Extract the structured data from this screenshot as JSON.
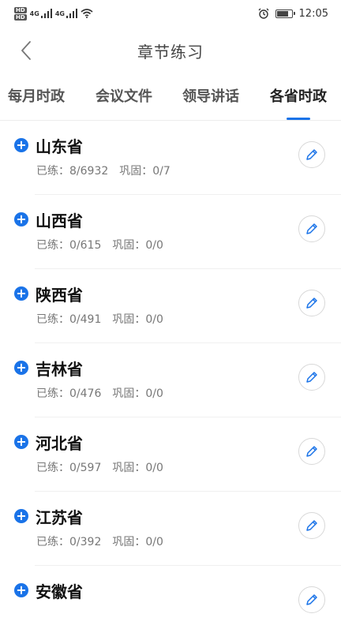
{
  "status_bar": {
    "time": "12:05",
    "network_1": "4G",
    "network_2": "4G",
    "hd_1": "HD",
    "hd_2": "HD"
  },
  "header": {
    "title": "章节练习"
  },
  "tabs": [
    {
      "label": "每月时政",
      "active": false
    },
    {
      "label": "会议文件",
      "active": false
    },
    {
      "label": "领导讲话",
      "active": false
    },
    {
      "label": "各省时政",
      "active": true
    }
  ],
  "accent_color": "#1a73e8",
  "items": [
    {
      "name": "山东省",
      "practiced_label": "已练：",
      "practiced": "8/6932",
      "review_label": "巩固：",
      "review": "0/7"
    },
    {
      "name": "山西省",
      "practiced_label": "已练：",
      "practiced": "0/615",
      "review_label": "巩固：",
      "review": "0/0"
    },
    {
      "name": "陕西省",
      "practiced_label": "已练：",
      "practiced": "0/491",
      "review_label": "巩固：",
      "review": "0/0"
    },
    {
      "name": "吉林省",
      "practiced_label": "已练：",
      "practiced": "0/476",
      "review_label": "巩固：",
      "review": "0/0"
    },
    {
      "name": "河北省",
      "practiced_label": "已练：",
      "practiced": "0/597",
      "review_label": "巩固：",
      "review": "0/0"
    },
    {
      "name": "江苏省",
      "practiced_label": "已练：",
      "practiced": "0/392",
      "review_label": "巩固：",
      "review": "0/0"
    },
    {
      "name": "安徽省",
      "practiced_label": "",
      "practiced": "",
      "review_label": "",
      "review": ""
    }
  ]
}
